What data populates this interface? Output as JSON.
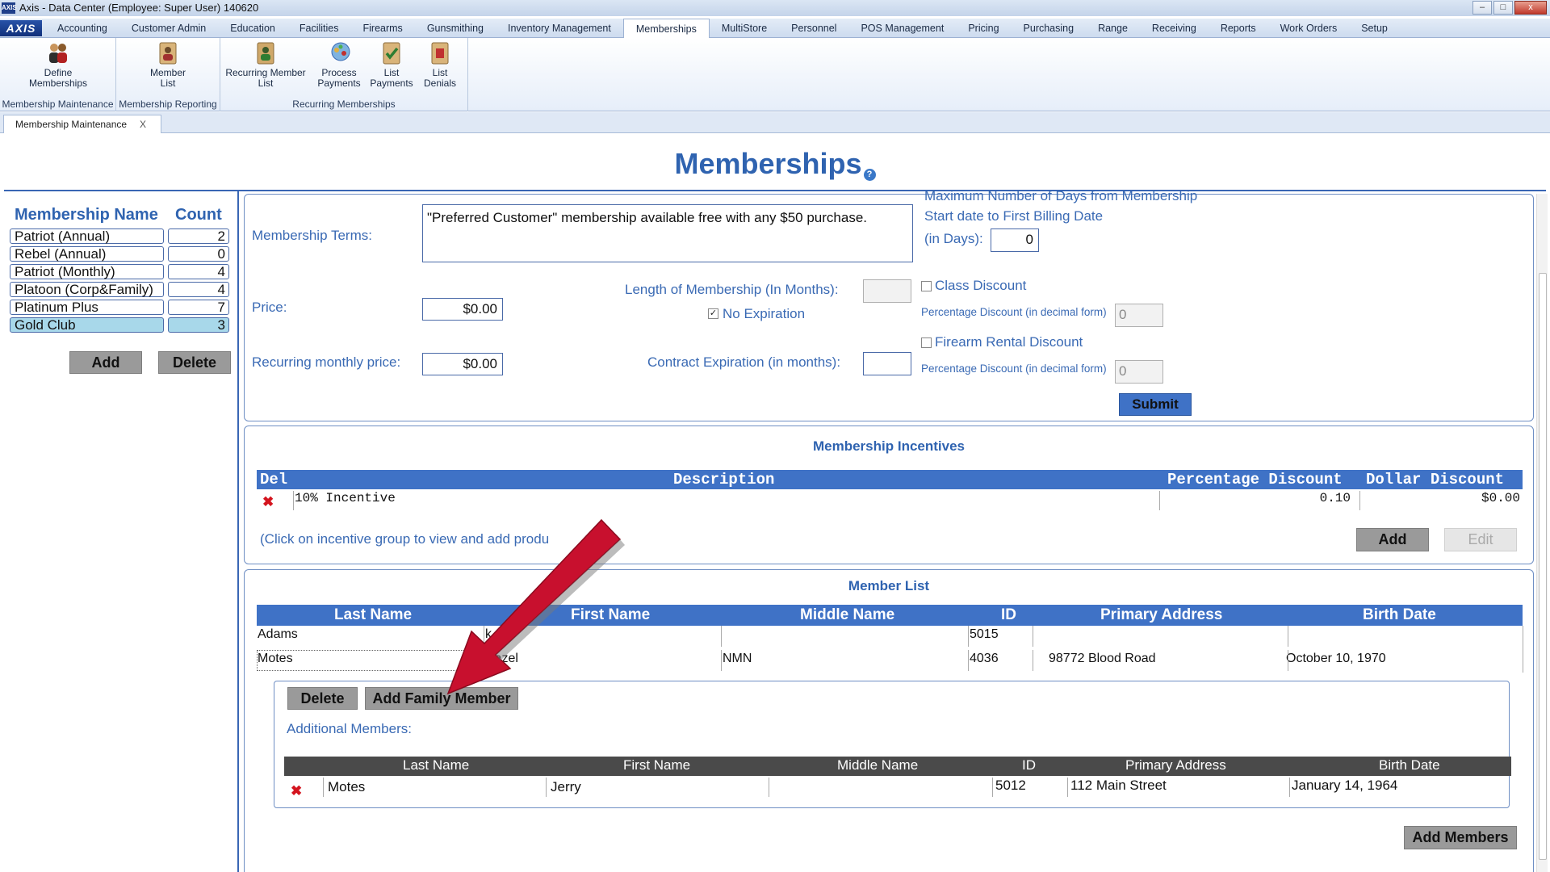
{
  "window": {
    "title": "Axis - Data Center  (Employee: Super User) 140620",
    "app_icon": "axis-app-icon",
    "minimize": "–",
    "maximize": "□",
    "close": "x"
  },
  "menubar": {
    "logo": "AXIS",
    "tabs": [
      "Accounting",
      "Customer Admin",
      "Education",
      "Facilities",
      "Firearms",
      "Gunsmithing",
      "Inventory Management",
      "Memberships",
      "MultiStore",
      "Personnel",
      "POS Management",
      "Pricing",
      "Purchasing",
      "Range",
      "Receiving",
      "Reports",
      "Work Orders",
      "Setup"
    ],
    "active_tab": "Memberships"
  },
  "ribbon": {
    "groups": [
      {
        "label": "Membership Maintenance",
        "buttons": [
          {
            "label": "Define\nMemberships",
            "icon": "people-icon"
          }
        ]
      },
      {
        "label": "Membership Reporting",
        "buttons": [
          {
            "label": "Member\nList",
            "icon": "member-list-icon"
          }
        ]
      },
      {
        "label": "Recurring Memberships",
        "buttons": [
          {
            "label": "Recurring Member\nList",
            "icon": "recurring-list-icon"
          },
          {
            "label": "Process\nPayments",
            "icon": "process-payments-icon"
          },
          {
            "label": "List\nPayments",
            "icon": "list-payments-icon"
          },
          {
            "label": "List\nDenials",
            "icon": "list-denials-icon"
          }
        ]
      }
    ]
  },
  "doc_tab": {
    "label": "Membership Maintenance",
    "close": "X"
  },
  "page_title": "Memberships",
  "help": "?",
  "membership_list": {
    "headers": {
      "name": "Membership Name",
      "count": "Count"
    },
    "rows": [
      {
        "name": "Patriot (Annual)",
        "count": "2"
      },
      {
        "name": "Rebel (Annual)",
        "count": "0"
      },
      {
        "name": "Patriot (Monthly)",
        "count": "4"
      },
      {
        "name": "Platoon (Corp&Family)",
        "count": "4"
      },
      {
        "name": "Platinum Plus",
        "count": "7"
      },
      {
        "name": "Gold Club",
        "count": "3"
      }
    ],
    "selected": "Gold Club",
    "add_label": "Add",
    "delete_label": "Delete"
  },
  "form": {
    "terms_label": "Membership Terms:",
    "terms_value": "\"Preferred Customer\" membership available free with any $50 purchase.",
    "price_label": "Price:",
    "price_value": "$0.00",
    "recurring_label": "Recurring monthly price:",
    "recurring_value": "$0.00",
    "length_label": "Length of Membership (In Months):",
    "length_value": "",
    "no_expiration_label": "No Expiration",
    "no_expiration_checked": true,
    "contract_label": "Contract Expiration (in months):",
    "contract_value": "",
    "max_days_line1": "Maximum Number of Days from Membership",
    "max_days_line2": "Start date to First Billing Date",
    "max_days_line3": "(in Days):",
    "max_days_value": "0",
    "class_discount_label": "Class Discount",
    "class_pct_label": "Percentage Discount (in decimal form)",
    "class_pct_value": "0",
    "firearm_discount_label": "Firearm Rental Discount",
    "firearm_pct_label": "Percentage Discount (in decimal form)",
    "firearm_pct_value": "0",
    "submit_label": "Submit"
  },
  "incentives": {
    "title": "Membership Incentives",
    "headers": {
      "del": "Del",
      "description": "Description",
      "pct": "Percentage Discount",
      "dollar": "Dollar Discount"
    },
    "rows": [
      {
        "description": "10% Incentive",
        "pct": "0.10",
        "dollar": "$0.00"
      }
    ],
    "hint": "(Click on incentive group to view and add produ",
    "add_label": "Add",
    "edit_label": "Edit"
  },
  "members": {
    "title": "Member List",
    "headers": {
      "last": "Last Name",
      "first": "First Name",
      "middle": "Middle Name",
      "id": "ID",
      "address": "Primary Address",
      "birth": "Birth Date"
    },
    "rows": [
      {
        "last": "Adams",
        "first": "k",
        "middle": "",
        "id": "5015",
        "address": "",
        "birth": ""
      },
      {
        "last": "Motes",
        "first": "Hazel",
        "middle": "NMN",
        "id": "4036",
        "address": "98772 Blood Road",
        "birth": "October 10, 1970"
      }
    ],
    "delete_label": "Delete",
    "add_family_label": "Add Family Member",
    "additional_label": "Additional Members:",
    "additional_rows": [
      {
        "last": "Motes",
        "first": "Jerry",
        "middle": "",
        "id": "5012",
        "address": "112 Main Street",
        "birth": "January 14, 1964"
      }
    ],
    "add_members_label": "Add Members"
  },
  "annotation": {
    "color": "#c8102e",
    "icon": "red-arrow-pointer"
  }
}
